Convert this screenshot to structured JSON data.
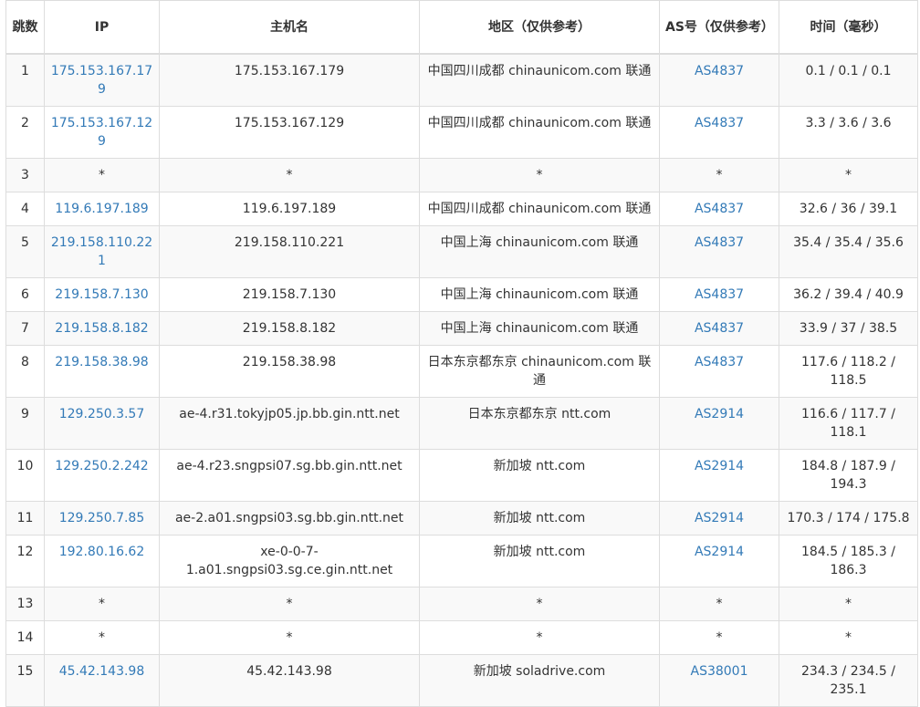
{
  "headers": {
    "hop": "跳数",
    "ip": "IP",
    "hostname": "主机名",
    "geo": "地区（仅供参考）",
    "as": "AS号（仅供参考）",
    "time": "时间（毫秒）"
  },
  "rows": [
    {
      "hop": "1",
      "ip": "175.153.167.179",
      "hostname": "175.153.167.179",
      "geo": "中国四川成都 chinaunicom.com 联通",
      "as": "AS4837",
      "time": "0.1 / 0.1 / 0.1",
      "lines": 1
    },
    {
      "hop": "2",
      "ip": "175.153.167.129",
      "hostname": "175.153.167.129",
      "geo": "中国四川成都 chinaunicom.com 联通",
      "as": "AS4837",
      "time": "3.3 / 3.6 / 3.6",
      "lines": 1
    },
    {
      "hop": "3",
      "ip": "*",
      "hostname": "*",
      "geo": "*",
      "as": "*",
      "time": "*",
      "lines": 1
    },
    {
      "hop": "4",
      "ip": "119.6.197.189",
      "hostname": "119.6.197.189",
      "geo": "中国四川成都 chinaunicom.com 联通",
      "as": "AS4837",
      "time": "32.6 / 36 / 39.1",
      "lines": 1
    },
    {
      "hop": "5",
      "ip": "219.158.110.221",
      "hostname": "219.158.110.221",
      "geo": "中国上海 chinaunicom.com 联通",
      "as": "AS4837",
      "time": "35.4 / 35.4 / 35.6",
      "lines": 1
    },
    {
      "hop": "6",
      "ip": "219.158.7.130",
      "hostname": "219.158.7.130",
      "geo": "中国上海 chinaunicom.com 联通",
      "as": "AS4837",
      "time": "36.2 / 39.4 / 40.9",
      "lines": 1
    },
    {
      "hop": "7",
      "ip": "219.158.8.182",
      "hostname": "219.158.8.182",
      "geo": "中国上海 chinaunicom.com 联通",
      "as": "AS4837",
      "time": "33.9 / 37 / 38.5",
      "lines": 1
    },
    {
      "hop": "8",
      "ip": "219.158.38.98",
      "hostname": "219.158.38.98",
      "geo": "日本东京都东京 chinaunicom.com 联通",
      "as": "AS4837",
      "time": "117.6 / 118.2 / 118.5",
      "lines": 2
    },
    {
      "hop": "9",
      "ip": "129.250.3.57",
      "hostname": "ae-4.r31.tokyjp05.jp.bb.gin.ntt.net",
      "geo": "日本东京都东京 ntt.com",
      "as": "AS2914",
      "time": "116.6 / 117.7 / 118.1",
      "lines": 2
    },
    {
      "hop": "10",
      "ip": "129.250.2.242",
      "hostname": "ae-4.r23.sngpsi07.sg.bb.gin.ntt.net",
      "geo": "新加坡 ntt.com",
      "as": "AS2914",
      "time": "184.8 / 187.9 / 194.3",
      "lines": 2
    },
    {
      "hop": "11",
      "ip": "129.250.7.85",
      "hostname": "ae-2.a01.sngpsi03.sg.bb.gin.ntt.net",
      "geo": "新加坡 ntt.com",
      "as": "AS2914",
      "time": "170.3 / 174 / 175.8",
      "lines": 1
    },
    {
      "hop": "12",
      "ip": "192.80.16.62",
      "hostname": "xe-0-0-7-1.a01.sngpsi03.sg.ce.gin.ntt.net",
      "geo": "新加坡 ntt.com",
      "as": "AS2914",
      "time": "184.5 / 185.3 / 186.3",
      "lines": 2
    },
    {
      "hop": "13",
      "ip": "*",
      "hostname": "*",
      "geo": "*",
      "as": "*",
      "time": "*",
      "lines": 1
    },
    {
      "hop": "14",
      "ip": "*",
      "hostname": "*",
      "geo": "*",
      "as": "*",
      "time": "*",
      "lines": 1
    },
    {
      "hop": "15",
      "ip": "45.42.143.98",
      "hostname": "45.42.143.98",
      "geo": "新加坡 soladrive.com",
      "as": "AS38001",
      "time": "234.3 / 234.5 / 235.1",
      "lines": 2
    }
  ]
}
